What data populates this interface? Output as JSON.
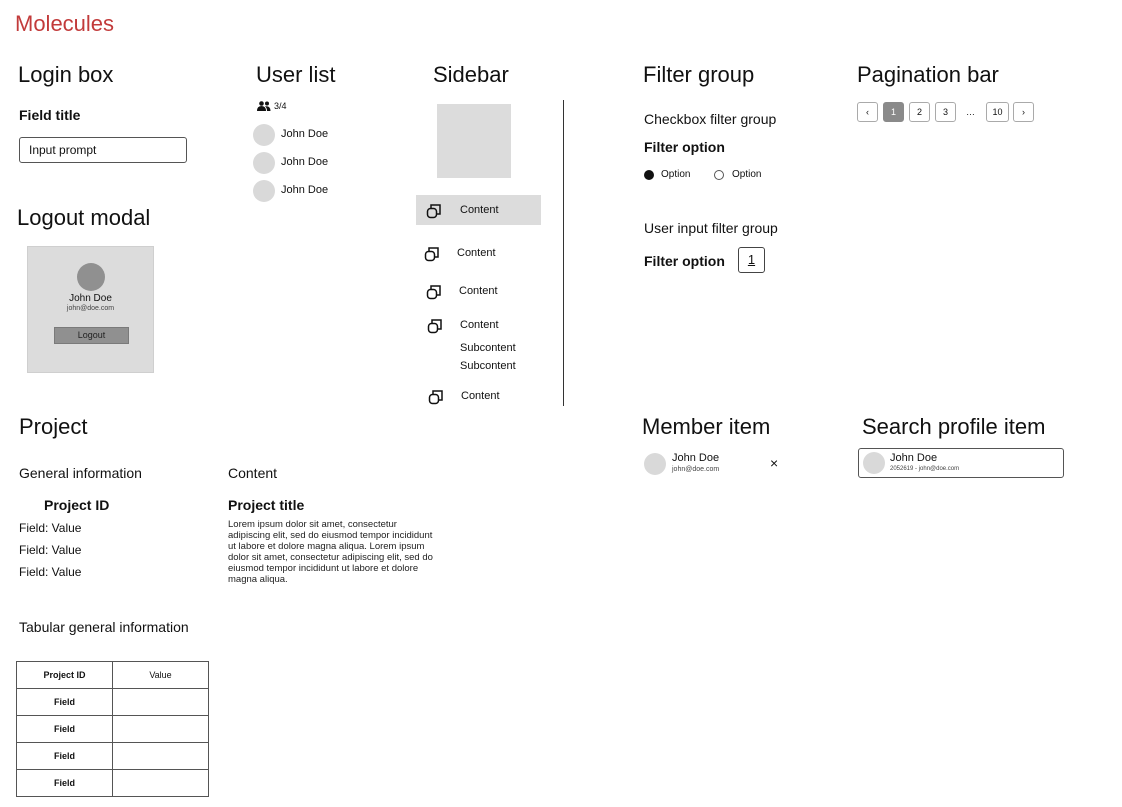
{
  "page": {
    "title": "Molecules"
  },
  "login_box": {
    "heading": "Login box",
    "field_title": "Field title",
    "input_prompt": "Input prompt"
  },
  "logout_modal": {
    "heading": "Logout modal",
    "name": "John Doe",
    "email": "john@doe.com",
    "button": "Logout"
  },
  "user_list": {
    "heading": "User list",
    "count": "3/4",
    "users": [
      "John Doe",
      "John Doe",
      "John Doe"
    ]
  },
  "sidebar": {
    "heading": "Sidebar",
    "items": [
      "Content",
      "Content",
      "Content",
      "Content",
      "Content"
    ],
    "subitems": [
      "Subcontent",
      "Subcontent"
    ]
  },
  "filter_group": {
    "heading": "Filter group",
    "checkbox_title": "Checkbox filter group",
    "filter_option": "Filter option",
    "options": [
      "Option",
      "Option"
    ],
    "user_input_title": "User input filter group",
    "input_label": "Filter option",
    "input_value": "1"
  },
  "pagination": {
    "heading": "Pagination bar",
    "prev": "‹",
    "pages": [
      "1",
      "2",
      "3"
    ],
    "ellipsis": "…",
    "last": "10",
    "next": "›",
    "active_page": "1"
  },
  "project": {
    "heading": "Project",
    "general_info": "General information",
    "project_id": "Project ID",
    "fields": [
      "Field: Value",
      "Field: Value",
      "Field: Value"
    ],
    "content_label": "Content",
    "project_title": "Project title",
    "lorem": "Lorem ipsum dolor sit amet, consectetur adipiscing elit, sed do eiusmod tempor incididunt ut labore et dolore magna aliqua. Lorem ipsum dolor sit amet, consectetur adipiscing elit, sed do eiusmod tempor incididunt ut labore et dolore magna aliqua.",
    "tabular_title": "Tabular general information",
    "table": {
      "header": [
        "Project ID",
        "Value"
      ],
      "rows": [
        "Field",
        "Field",
        "Field",
        "Field"
      ]
    }
  },
  "member_item": {
    "heading": "Member item",
    "name": "John Doe",
    "email": "john@doe.com",
    "remove": "×"
  },
  "search_profile": {
    "heading": "Search profile item",
    "name": "John Doe",
    "detail": "2052619 - john@doe.com"
  }
}
